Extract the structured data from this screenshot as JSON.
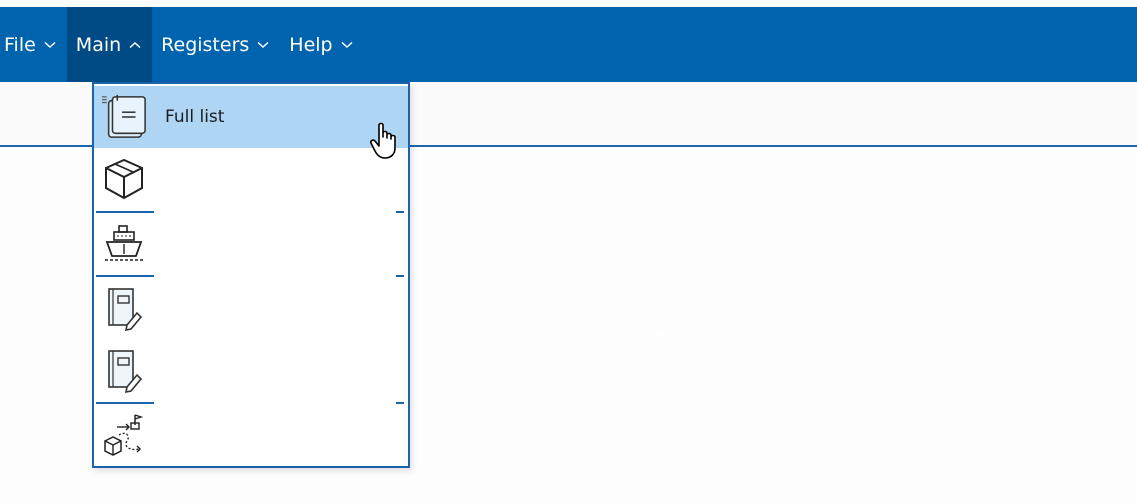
{
  "menubar": {
    "items": [
      {
        "label": "File",
        "chevron": "down"
      },
      {
        "label": "Main",
        "chevron": "up"
      },
      {
        "label": "Registers",
        "chevron": "down"
      },
      {
        "label": "Help",
        "chevron": "down"
      }
    ],
    "active_item": "Main"
  },
  "main_menu": {
    "items": [
      {
        "label": "Full list",
        "icon": "document-list-icon",
        "highlighted": true
      },
      {
        "label": "",
        "icon": "package-box-icon"
      },
      {
        "label": "",
        "icon": "ship-icon"
      },
      {
        "label": "",
        "icon": "document-edit-icon"
      },
      {
        "label": "",
        "icon": "document-edit-icon"
      },
      {
        "label": "",
        "icon": "route-package-flag-icon"
      }
    ]
  },
  "colors": {
    "menubar_bg": "#0063ae",
    "active_menu_bg": "#004b86",
    "highlight_bg": "#aed6f4",
    "border": "#1b63ad"
  }
}
